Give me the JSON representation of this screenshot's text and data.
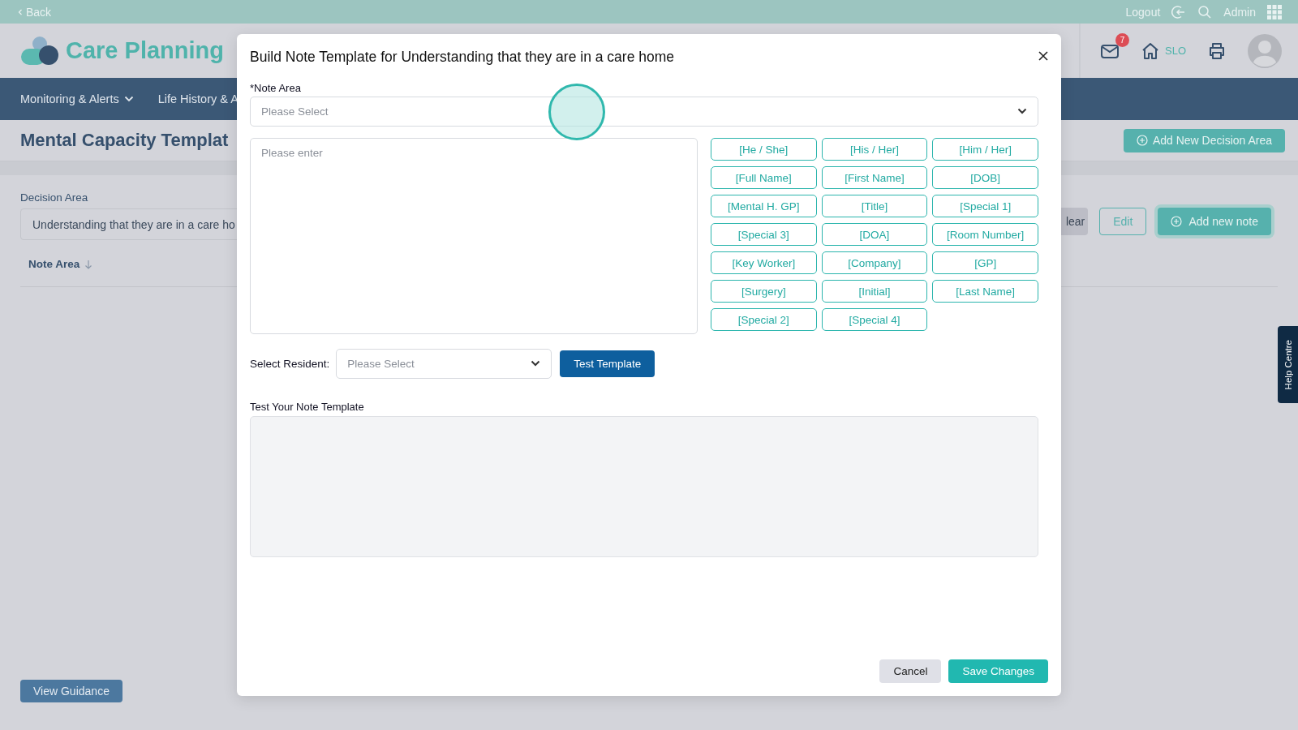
{
  "top_bar": {
    "back_link": "Back",
    "logout": "Logout",
    "user": "Admin"
  },
  "header": {
    "app_name": "Care Planning",
    "notifications": "7",
    "home_label": "SLO"
  },
  "nav": [
    {
      "label": "Monitoring & Alerts",
      "dropdown": true
    },
    {
      "label": "Life History & A",
      "dropdown": false
    }
  ],
  "page": {
    "title": "Mental Capacity Templat",
    "add_decision_button": "Add New Decision Area",
    "decision_label": "Decision Area",
    "decision_value": "Understanding that they are in a care ho",
    "actions": [
      {
        "label": "lear",
        "kind": "clear"
      },
      {
        "label": "Edit",
        "kind": "outline"
      },
      {
        "label": "Add new note",
        "kind": "primary"
      }
    ],
    "table_header": "Note Area",
    "guidance_button": "View Guidance"
  },
  "help_tab": "Help Centre",
  "modal": {
    "title": "Build Note Template for Understanding that they are in a care home",
    "note_area": {
      "label": "*Note Area",
      "placeholder": "Please Select"
    },
    "note_text": {
      "placeholder": "Please enter"
    },
    "tokens": [
      "[He / She]",
      "[His / Her]",
      "[Him / Her]",
      "[Full Name]",
      "[First Name]",
      "[DOB]",
      "[Mental H. GP]",
      "[Title]",
      "[Special 1]",
      "[Special 3]",
      "[DOA]",
      "[Room Number]",
      "[Key Worker]",
      "[Company]",
      "[GP]",
      "[Surgery]",
      "[Initial]",
      "[Last Name]",
      "[Special 2]",
      "[Special 4]"
    ],
    "resident": {
      "label": "Select Resident:",
      "placeholder": "Please Select"
    },
    "test_button": "Test Template",
    "preview_label": "Test Your Note Template",
    "buttons": [
      {
        "label": "Cancel",
        "kind": "secondary"
      },
      {
        "label": "Save Changes",
        "kind": "primary"
      }
    ]
  }
}
